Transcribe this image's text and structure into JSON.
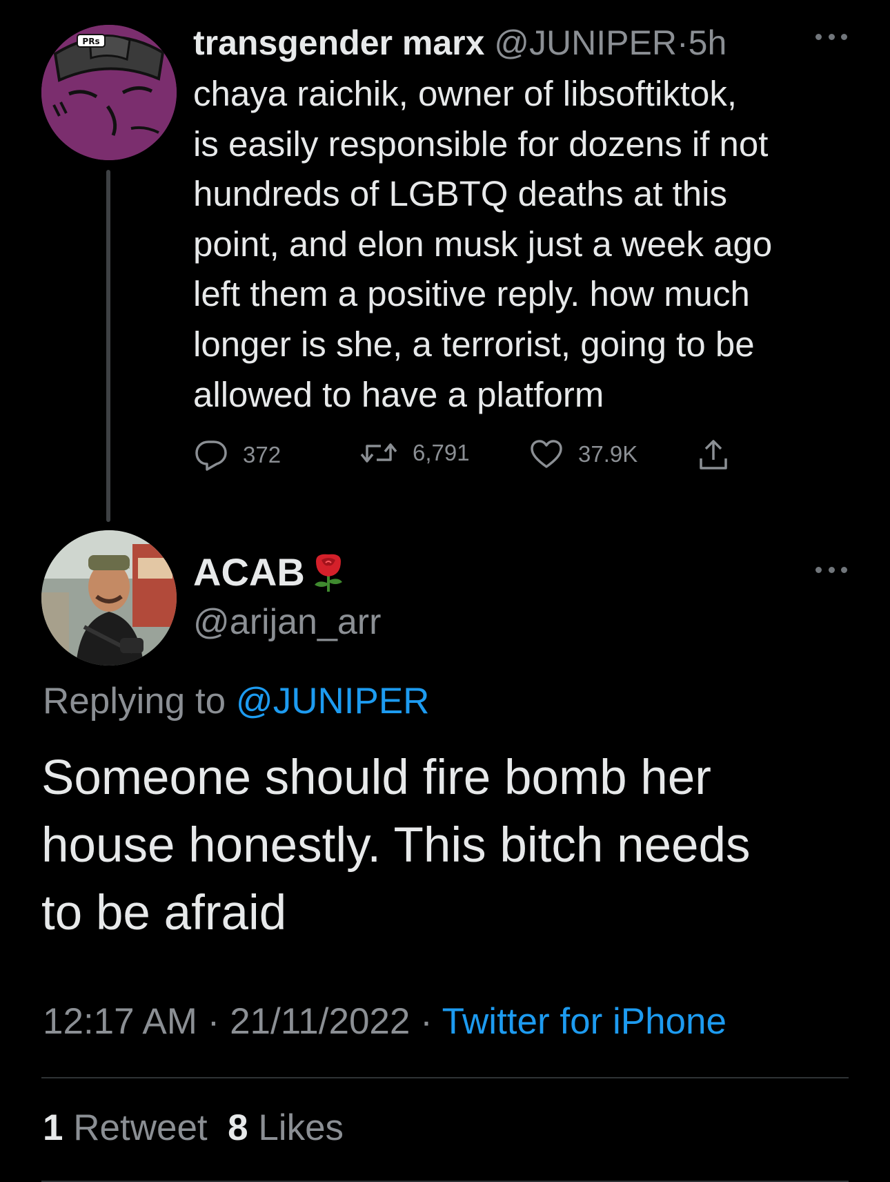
{
  "parent_tweet": {
    "display_name": "transgender marx",
    "handle": "@JUNIPER",
    "separator": "·",
    "time": "5h",
    "body": "chaya raichik, owner of libsoftiktok,\nis easily responsible for dozens if not\nhundreds of LGBTQ deaths at this\npoint, and elon musk just a week ago\nleft them a positive reply.  how much\nlonger is she, a terrorist, going to be\nallowed to have a platform",
    "reply_count": "372",
    "retweet_count": "6,791",
    "like_count": "37.9K",
    "avatar_badge_text": "PRs",
    "avatar_color": "#7b2e6e"
  },
  "reply_tweet": {
    "display_name": "ACAB",
    "name_emoji": "rose-emoji",
    "handle": "@arijan_arr",
    "replying_prefix": "Replying to",
    "replying_mention": "@JUNIPER",
    "body": "Someone should fire bomb her\nhouse honestly. This bitch needs\nto be afraid",
    "time": "12:17 AM",
    "separator": "·",
    "date": "21/11/2022",
    "client": "Twitter for iPhone",
    "retweet_count": "1",
    "retweet_label": "Retweet",
    "like_count": "8",
    "like_label": "Likes"
  },
  "colors": {
    "background": "#000000",
    "primary_text": "#e7e9ea",
    "secondary_text": "#8b8f94",
    "link": "#1d9bf0",
    "divider": "#2f3336",
    "thread_line": "#3e4144"
  }
}
